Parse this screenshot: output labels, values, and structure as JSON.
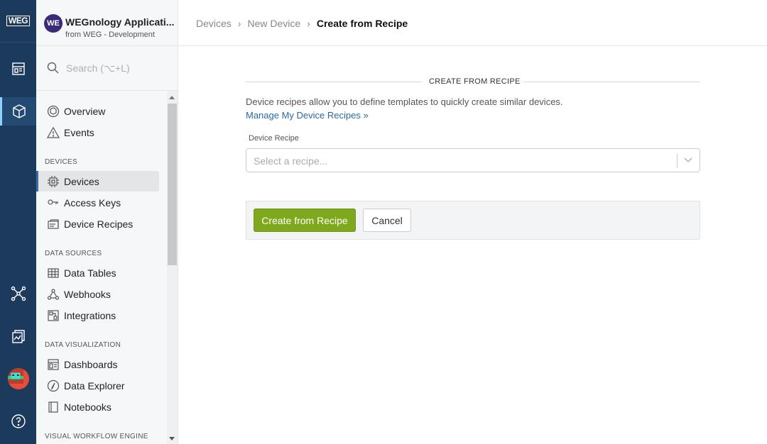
{
  "rail": {
    "logo_text": "WEG",
    "items": [
      {
        "icon": "dashboard-icon"
      },
      {
        "icon": "cube-icon",
        "active": true
      },
      {
        "icon": "network-icon"
      },
      {
        "icon": "reports-icon"
      },
      {
        "icon": "user-avatar"
      },
      {
        "icon": "help-icon"
      }
    ]
  },
  "app": {
    "badge": "WE",
    "name": "WEGnology Applicati...",
    "subtitle": "from WEG - Development"
  },
  "search": {
    "placeholder": "Search (⌥+L)"
  },
  "sidebar": {
    "top_items": [
      {
        "label": "Overview",
        "icon": "overview-icon"
      },
      {
        "label": "Events",
        "icon": "warning-icon"
      }
    ],
    "sections": [
      {
        "title": "DEVICES",
        "items": [
          {
            "label": "Devices",
            "icon": "chip-icon",
            "active": true
          },
          {
            "label": "Access Keys",
            "icon": "key-icon"
          },
          {
            "label": "Device Recipes",
            "icon": "recipe-icon"
          }
        ]
      },
      {
        "title": "DATA SOURCES",
        "items": [
          {
            "label": "Data Tables",
            "icon": "table-icon"
          },
          {
            "label": "Webhooks",
            "icon": "webhook-icon"
          },
          {
            "label": "Integrations",
            "icon": "integrations-icon"
          }
        ]
      },
      {
        "title": "DATA VISUALIZATION",
        "items": [
          {
            "label": "Dashboards",
            "icon": "dashboard-icon"
          },
          {
            "label": "Data Explorer",
            "icon": "compass-icon"
          },
          {
            "label": "Notebooks",
            "icon": "notebook-icon"
          }
        ]
      },
      {
        "title": "VISUAL WORKFLOW ENGINE",
        "items": []
      }
    ]
  },
  "breadcrumb": {
    "items": [
      "Devices",
      "New Device",
      "Create from Recipe"
    ]
  },
  "form": {
    "section_title": "CREATE FROM RECIPE",
    "description": "Device recipes allow you to define templates to quickly create similar devices.",
    "manage_link": "Manage My Device Recipes »",
    "recipe_label": "Device Recipe",
    "recipe_placeholder": "Select a recipe...",
    "submit_label": "Create from Recipe",
    "cancel_label": "Cancel"
  },
  "colors": {
    "rail": "#1c3a5b",
    "primary_button": "#7fa91d",
    "link": "#2a6aa3"
  }
}
